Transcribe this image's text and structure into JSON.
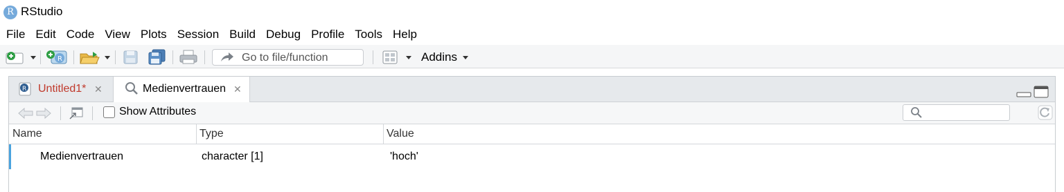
{
  "window": {
    "title": "RStudio",
    "logo_letter": "R"
  },
  "menu": [
    "File",
    "Edit",
    "Code",
    "View",
    "Plots",
    "Session",
    "Build",
    "Debug",
    "Profile",
    "Tools",
    "Help"
  ],
  "toolbar": {
    "goto_placeholder": "Go to file/function",
    "addins_label": "Addins"
  },
  "tabs": [
    {
      "label": "Untitled1*",
      "active": false,
      "color": "#c0392b"
    },
    {
      "label": "Medienvertrauen",
      "active": true
    }
  ],
  "viewer": {
    "show_attributes_label": "Show Attributes",
    "show_attributes_checked": false,
    "search_placeholder": "",
    "columns": [
      "Name",
      "Type",
      "Value"
    ],
    "rows": [
      {
        "name": "Medienvertrauen",
        "type": "character [1]",
        "value": "'hoch'"
      }
    ]
  },
  "colors": {
    "accent": "#4aa3df",
    "toolbar_bg": "#f5f6f7",
    "tab_bg": "#e6e9ec"
  }
}
